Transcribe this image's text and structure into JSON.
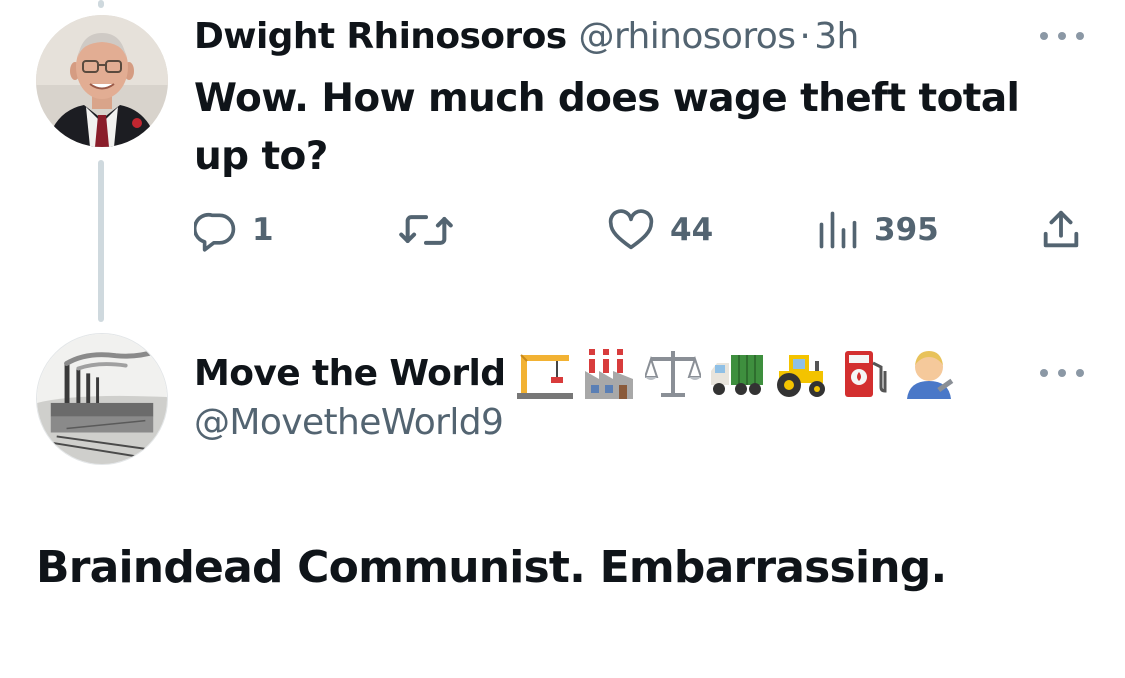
{
  "post1": {
    "display_name": "Dwight Rhinosoros",
    "handle": "@rhinosoros",
    "separator": "·",
    "time": "3h",
    "text": "Wow. How much does wage theft total up to?",
    "actions": {
      "reply_count": "1",
      "retweet_count": "",
      "like_count": "44",
      "views_count": "395"
    }
  },
  "post2": {
    "display_name": "Move the World",
    "name_emoji": [
      "construction-crane",
      "factory",
      "balance-scale",
      "truck",
      "tractor",
      "fuel-pump",
      "mechanic"
    ],
    "handle": "@MovetheWorld9",
    "text": "Braindead Communist. Embarrassing."
  },
  "icons": [
    "reply-icon",
    "retweet-icon",
    "like-icon",
    "views-icon",
    "share-icon",
    "more-icon"
  ],
  "colors": {
    "text_primary": "#0f1419",
    "text_secondary": "#536471",
    "thread_line": "#cfd9de"
  }
}
